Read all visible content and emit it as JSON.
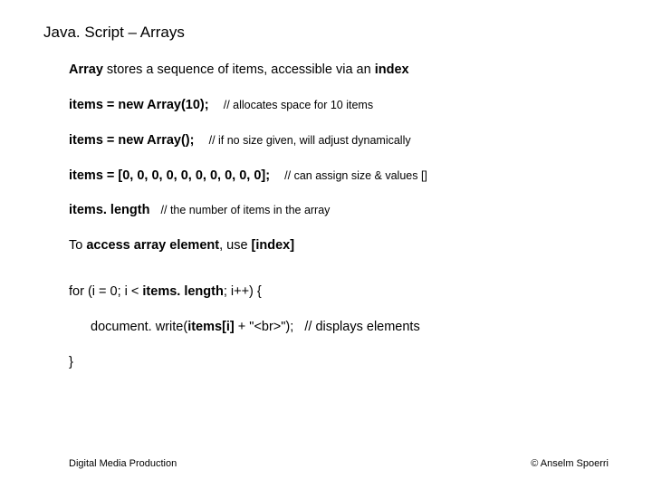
{
  "title": "Java. Script – Arrays",
  "lines": {
    "l1a": "Array",
    "l1b": " stores a sequence of items, accessible via an ",
    "l1c": "index",
    "l2a": "items = new Array(10);",
    "l2b": "// allocates space for 10 items",
    "l3a": "items = new Array();",
    "l3b": "// if no size given, will adjust dynamically",
    "l4a": "items = [0, 0, 0, 0, 0, 0, 0, 0, 0, 0];",
    "l4b": "// can assign size & values []",
    "l5a": "items. length",
    "l5b": "// the number of items in the array",
    "l6a": "To ",
    "l6b": "access array element",
    "l6c": ", use ",
    "l6d": "[index]",
    "l7a": "for (i = 0; i < ",
    "l7b": "items. length",
    "l7c": "; i++) {",
    "l8a": "document. write(",
    "l8b": "items[i]",
    "l8c": " + \"<br>\");",
    "l8d": "// displays elements",
    "l9": "}"
  },
  "footer": {
    "left": "Digital Media Production",
    "right": "© Anselm Spoerri"
  }
}
